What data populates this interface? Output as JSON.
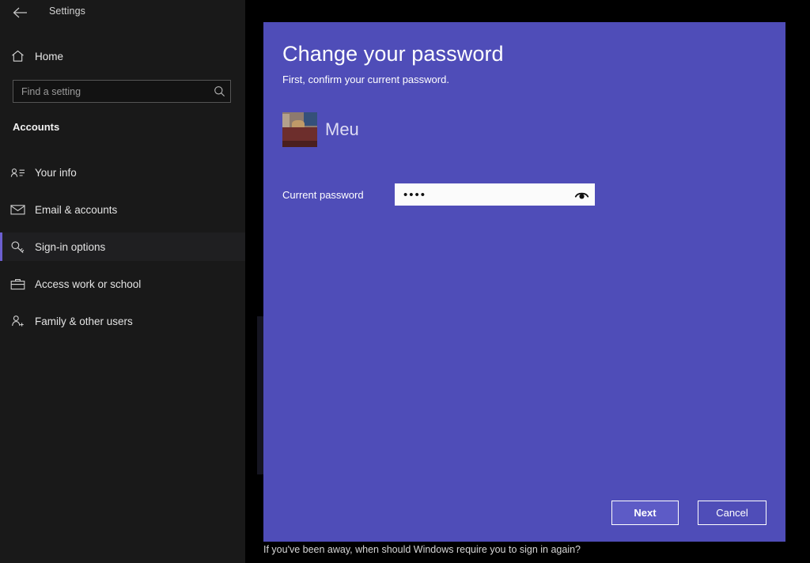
{
  "window": {
    "title": "Settings",
    "back_icon": "back-arrow-icon"
  },
  "sidebar": {
    "home": {
      "label": "Home",
      "icon": "home-icon"
    },
    "search": {
      "placeholder": "Find a setting",
      "value": "",
      "icon": "search-icon"
    },
    "group_heading": "Accounts",
    "items": [
      {
        "label": "Your info",
        "icon": "contact-card-icon",
        "selected": false
      },
      {
        "label": "Email & accounts",
        "icon": "envelope-icon",
        "selected": false
      },
      {
        "label": "Sign-in options",
        "icon": "key-icon",
        "selected": true
      },
      {
        "label": "Access work or school",
        "icon": "briefcase-icon",
        "selected": false
      },
      {
        "label": "Family & other users",
        "icon": "person-add-icon",
        "selected": false
      }
    ]
  },
  "dialog": {
    "title": "Change your password",
    "subtitle": "First, confirm your current password.",
    "account": {
      "name": "Meu",
      "avatar_icon": "user-photo-avatar"
    },
    "field": {
      "label": "Current password",
      "value": "••••",
      "placeholder": "",
      "reveal_icon": "eye-reveal-password-icon"
    },
    "buttons": {
      "primary": "Next",
      "secondary": "Cancel"
    }
  },
  "page_behind": {
    "bottom_note": "If you've been away, when should Windows require you to sign in again?"
  },
  "colors": {
    "dialog_bg": "#4F4DB8",
    "accent": "#6C5FD0",
    "primary_button": "#5D5BC6",
    "sidebar_bg": "#191919",
    "page_bg": "#000000"
  }
}
